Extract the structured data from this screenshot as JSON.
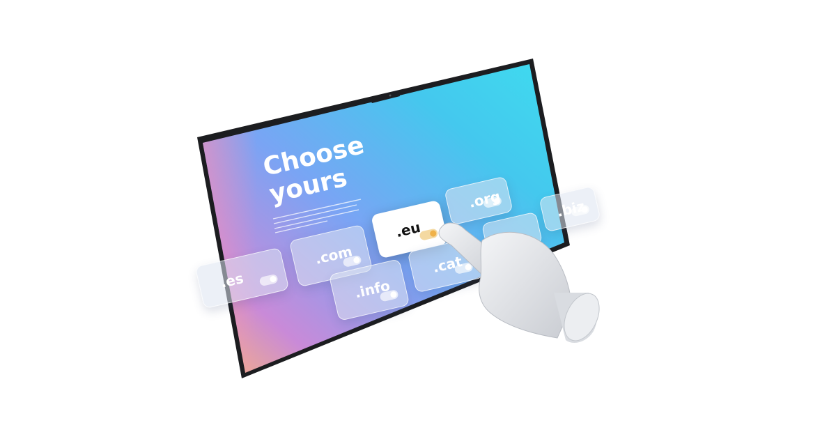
{
  "screen": {
    "headline_line1": "Choose",
    "headline_line2": "yours",
    "colors": {
      "gradient_start": "#f7b27a",
      "gradient_mid": "#7aa8f5",
      "gradient_end": "#3fd8ee",
      "bezel": "#1c1d20"
    }
  },
  "domains": [
    {
      "label": ".es",
      "selected": false
    },
    {
      "label": ".com",
      "selected": false
    },
    {
      "label": ".eu",
      "selected": true
    },
    {
      "label": ".org",
      "selected": false
    },
    {
      "label": ".biz",
      "selected": false
    },
    {
      "label": ".info",
      "selected": false
    },
    {
      "label": ".cat",
      "selected": false
    }
  ]
}
